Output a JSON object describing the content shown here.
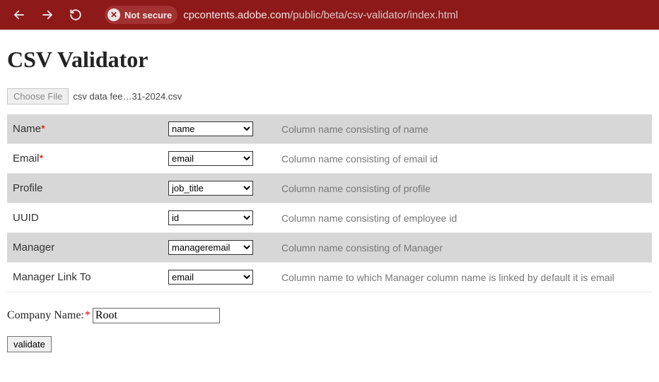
{
  "browser": {
    "not_secure_label": "Not secure",
    "url_host": "cpcontents.adobe.com",
    "url_path": "/public/beta/csv-validator/index.html"
  },
  "page": {
    "title": "CSV Validator",
    "choose_file_label": "Choose File",
    "file_name": "csv data fee…31-2024.csv",
    "required_mark": "*"
  },
  "fields": [
    {
      "label": "Name",
      "required": true,
      "value": "name",
      "desc": "Column name consisting of name"
    },
    {
      "label": "Email",
      "required": true,
      "value": "email",
      "desc": "Column name consisting of email id"
    },
    {
      "label": "Profile",
      "required": false,
      "value": "job_title",
      "desc": "Column name consisting of profile"
    },
    {
      "label": "UUID",
      "required": false,
      "value": "id",
      "desc": "Column name consisting of employee id"
    },
    {
      "label": "Manager",
      "required": false,
      "value": "manageremail",
      "desc": "Column name consisting of Manager"
    },
    {
      "label": "Manager Link To",
      "required": false,
      "value": "email",
      "desc": "Column name to which Manager column name is linked by default it is email"
    }
  ],
  "company": {
    "label": "Company Name:",
    "required": true,
    "value": "Root"
  },
  "validate_label": "validate"
}
